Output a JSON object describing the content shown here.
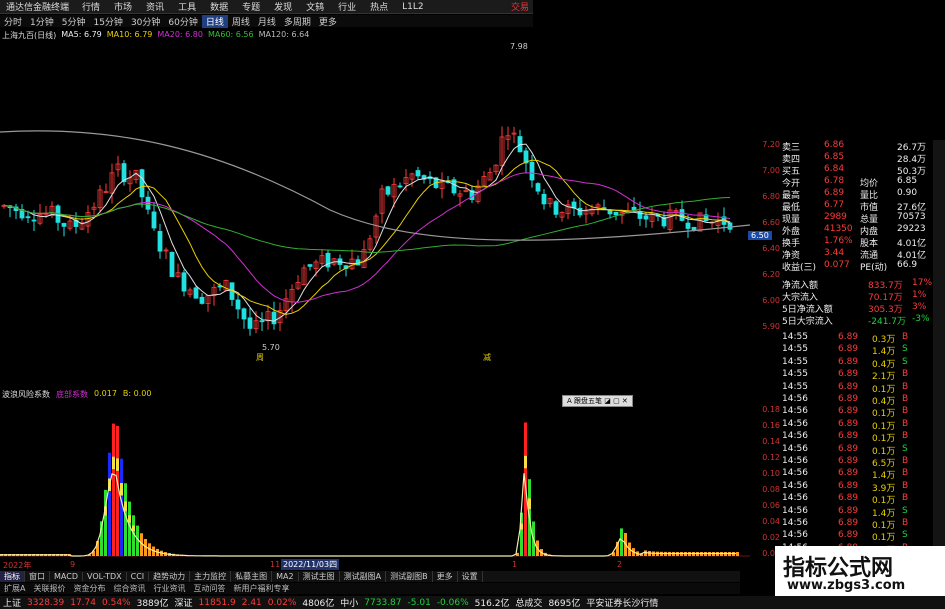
{
  "app": {
    "title": "通达信金融终端",
    "trade_label": "交易"
  },
  "menu": [
    "行情",
    "市场",
    "资讯",
    "工具",
    "数据",
    "专题",
    "发现",
    "文鸫",
    "行业",
    "热点",
    "L1L2"
  ],
  "periods": [
    "分时",
    "1分钟",
    "5分钟",
    "15分钟",
    "30分钟",
    "60分钟",
    "日线",
    "周线",
    "月线",
    "多周期",
    "更多"
  ],
  "active_period": "日线",
  "ma_legend": {
    "symbol": "上海九百(日线)",
    "ma5": "MA5: 6.79",
    "ma10": "MA10: 6.79",
    "ma20": "MA20: 6.80",
    "ma60": "MA60: 6.56",
    "ma120": "MA120: 6.64"
  },
  "annotations": {
    "high": "7.98",
    "low": "5.70",
    "mark_left": "周",
    "mark_right": "减"
  },
  "price_axis": [
    "7.20",
    "7.00",
    "6.80",
    "6.60",
    "6.40",
    "6.20",
    "6.00",
    "5.90"
  ],
  "price_tag": "6.50",
  "sub_legend": {
    "name": "波浪风险系数",
    "item1": "底部系数",
    "v1": "0.017",
    "item2": "B: 0.00"
  },
  "sub_axis": [
    "0.18",
    "0.16",
    "0.14",
    "0.12",
    "0.10",
    "0.08",
    "0.06",
    "0.04",
    "0.02",
    "0.00"
  ],
  "date_labels": {
    "d1": "2022年",
    "d2": "9",
    "d3": "11",
    "d4": "2022/11/03四",
    "d5": "1",
    "d6": "2"
  },
  "popup": "A 跟盘五笔 ◪ ▢ ✕",
  "quote": [
    {
      "l": "卖三",
      "v": "6.86",
      "r": "26.7万",
      "cls": "red"
    },
    {
      "l": "卖四",
      "v": "6.85",
      "r": "28.4万",
      "cls": "red"
    },
    {
      "l": "买五",
      "v": "6.84",
      "r": "50.3万",
      "cls": "red"
    },
    {
      "l": "今开",
      "v": "6.78",
      "l2": "均价",
      "r": "6.85"
    },
    {
      "l": "最高",
      "v": "6.89",
      "l2": "量比",
      "r": "0.90"
    },
    {
      "l": "最低",
      "v": "6.77",
      "l2": "市值",
      "r": "27.6亿"
    },
    {
      "l": "现量",
      "v": "2989",
      "l2": "总量",
      "r": "70573"
    },
    {
      "l": "外盘",
      "v": "41350",
      "l2": "内盘",
      "r": "29223"
    },
    {
      "l": "换手",
      "v": "1.76%",
      "l2": "股本",
      "r": "4.01亿"
    },
    {
      "l": "净资",
      "v": "3.44",
      "l2": "流通",
      "r": "4.01亿"
    },
    {
      "l": "收益(三)",
      "v": "0.077",
      "l2": "PE(动)",
      "r": "66.9"
    }
  ],
  "flow": [
    {
      "l": "净流入额",
      "v": "833.7万",
      "p": "17%"
    },
    {
      "l": "大宗流入",
      "v": "70.17万",
      "p": "1%"
    },
    {
      "l": "5日净流入额",
      "v": "305.3万",
      "p": "3%"
    },
    {
      "l": "5日大宗流入",
      "v": "-241.7万",
      "p": "-3%"
    }
  ],
  "ticks": [
    [
      "14:55",
      "6.89",
      "0.3万",
      "B"
    ],
    [
      "14:55",
      "6.89",
      "1.4万",
      "S"
    ],
    [
      "14:55",
      "6.89",
      "0.4万",
      "S"
    ],
    [
      "14:55",
      "6.89",
      "2.1万",
      "B"
    ],
    [
      "14:55",
      "6.89",
      "0.1万",
      "B"
    ],
    [
      "14:56",
      "6.89",
      "0.4万",
      "B"
    ],
    [
      "14:56",
      "6.89",
      "0.1万",
      "B"
    ],
    [
      "14:56",
      "6.89",
      "0.1万",
      "B"
    ],
    [
      "14:56",
      "6.89",
      "0.1万",
      "B"
    ],
    [
      "14:56",
      "6.89",
      "0.1万",
      "S"
    ],
    [
      "14:56",
      "6.89",
      "6.5万",
      "B"
    ],
    [
      "14:56",
      "6.89",
      "1.4万",
      "B"
    ],
    [
      "14:56",
      "6.89",
      "3.9万",
      "B"
    ],
    [
      "14:56",
      "6.89",
      "0.1万",
      "B"
    ],
    [
      "14:56",
      "6.89",
      "1.4万",
      "S"
    ],
    [
      "14:56",
      "6.89",
      "0.1万",
      "B"
    ],
    [
      "14:56",
      "6.89",
      "0.1万",
      "S"
    ],
    [
      "14:56",
      "6.89",
      "0.1万",
      "B"
    ],
    [
      "14:56",
      "6.89",
      "0.1万",
      "S"
    ],
    [
      "14:56",
      "6.89",
      "0.2万",
      "S"
    ]
  ],
  "tabs": [
    "指标",
    "窗口",
    "MACD",
    "VOL-TDX",
    "CCI",
    "趋势动力",
    "主力监控",
    "私募主图",
    "MA2",
    "测试主图",
    "测试副图A",
    "测试副图B",
    "更多",
    "设置"
  ],
  "tabs2": [
    "扩展A",
    "关联报价",
    "资金分布",
    "综合资讯",
    "行业资讯",
    "互动问答",
    "新用户福利专享"
  ],
  "status": [
    {
      "t": "上证",
      "c": "white"
    },
    {
      "t": "3328.39",
      "c": "red"
    },
    {
      "t": "17.74",
      "c": "red"
    },
    {
      "t": "0.54%",
      "c": "red"
    },
    {
      "t": "3889亿",
      "c": "white"
    },
    {
      "t": "深证",
      "c": "white"
    },
    {
      "t": "11851.9",
      "c": "red"
    },
    {
      "t": "2.41",
      "c": "red"
    },
    {
      "t": "0.02%",
      "c": "red"
    },
    {
      "t": "4806亿",
      "c": "white"
    },
    {
      "t": "中小",
      "c": "white"
    },
    {
      "t": "7733.87",
      "c": "green"
    },
    {
      "t": "-5.01",
      "c": "green"
    },
    {
      "t": "-0.06%",
      "c": "green"
    },
    {
      "t": "516.2亿",
      "c": "white"
    },
    {
      "t": "总成交",
      "c": "white"
    },
    {
      "t": "8695亿",
      "c": "white"
    },
    {
      "t": "平安证券长沙行情",
      "c": "white"
    }
  ],
  "watermark": {
    "title": "指标公式网",
    "url": "www.zbgs3.com"
  },
  "colors": {
    "up": "#ff3b3b",
    "down": "#20e0e0",
    "ma5": "#e0e0e0",
    "ma10": "#e8d000",
    "ma20": "#d030d0",
    "ma60": "#30b030",
    "ma120": "#999999"
  }
}
